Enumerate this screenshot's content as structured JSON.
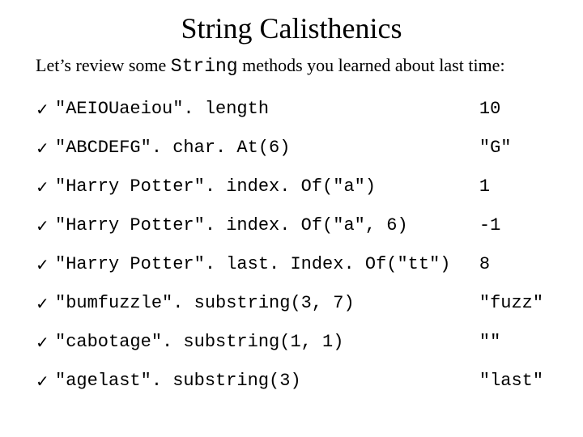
{
  "title": "String Calisthenics",
  "intro_prefix": "Let’s review some ",
  "intro_code": "String",
  "intro_suffix": " methods you learned about last time:",
  "check": "✓",
  "items": [
    {
      "expr": "\"AEIOUaeiou\". length",
      "result": "10"
    },
    {
      "expr": "\"ABCDEFG\". char. At(6)",
      "result": "\"G\""
    },
    {
      "expr": "\"Harry Potter\". index. Of(\"a\")",
      "result": "1"
    },
    {
      "expr": "\"Harry Potter\". index. Of(\"a\", 6)",
      "result": "-1"
    },
    {
      "expr": "\"Harry Potter\". last. Index. Of(\"tt\")",
      "result": "8"
    },
    {
      "expr": "\"bumfuzzle\". substring(3, 7)",
      "result": "\"fuzz\""
    },
    {
      "expr": "\"cabotage\". substring(1, 1)",
      "result": "\"\""
    },
    {
      "expr": "\"agelast\". substring(3)",
      "result": "\"last\""
    }
  ]
}
